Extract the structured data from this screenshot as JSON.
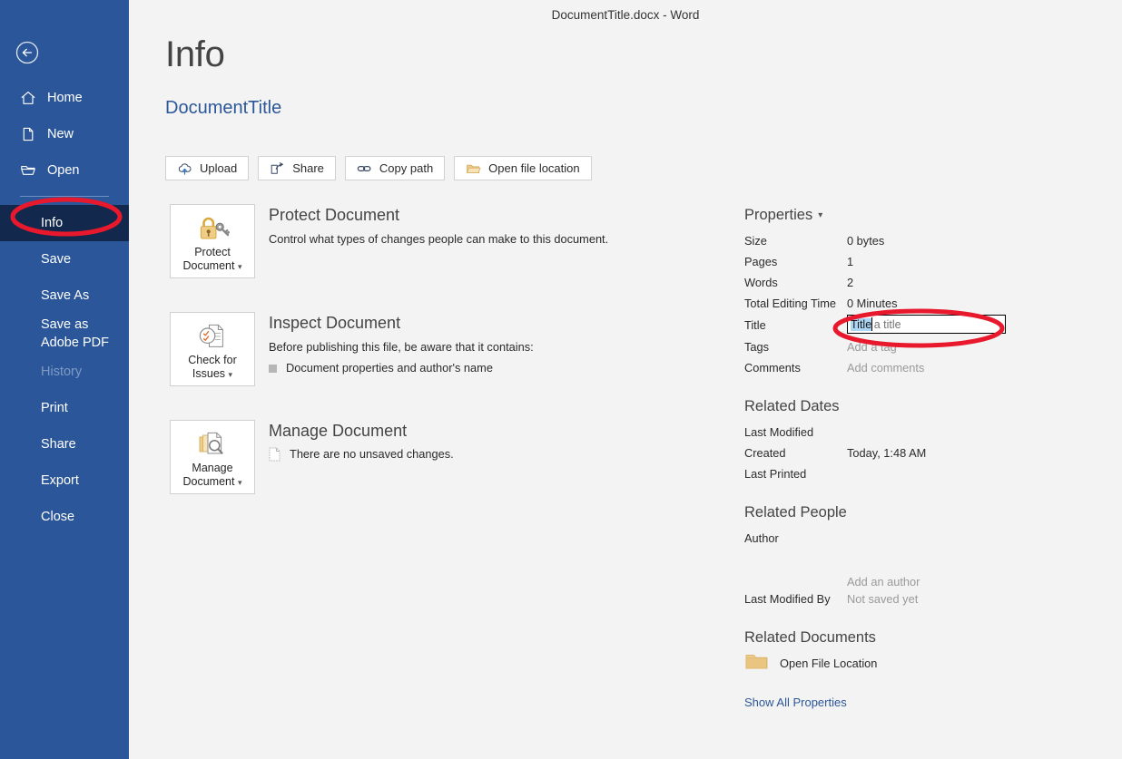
{
  "window": {
    "title": "DocumentTitle.docx  -  Word"
  },
  "sidebar": {
    "back_label": "Back",
    "items": [
      {
        "label": "Home",
        "icon": "home-icon",
        "state": "normal"
      },
      {
        "label": "New",
        "icon": "page-icon",
        "state": "normal"
      },
      {
        "label": "Open",
        "icon": "folder-icon",
        "state": "normal"
      },
      {
        "label": "Info",
        "icon": "",
        "state": "selected"
      },
      {
        "label": "Save",
        "icon": "",
        "state": "normal"
      },
      {
        "label": "Save As",
        "icon": "",
        "state": "normal"
      },
      {
        "label": "Save as Adobe PDF",
        "icon": "",
        "state": "normal"
      },
      {
        "label": "History",
        "icon": "",
        "state": "disabled"
      },
      {
        "label": "Print",
        "icon": "",
        "state": "normal"
      },
      {
        "label": "Share",
        "icon": "",
        "state": "normal"
      },
      {
        "label": "Export",
        "icon": "",
        "state": "normal"
      },
      {
        "label": "Close",
        "icon": "",
        "state": "normal"
      }
    ]
  },
  "page": {
    "heading": "Info",
    "document_name": "DocumentTitle"
  },
  "toolbar": [
    {
      "label": "Upload",
      "icon": "cloud-upload-icon"
    },
    {
      "label": "Share",
      "icon": "share-arrow-icon"
    },
    {
      "label": "Copy path",
      "icon": "link-icon"
    },
    {
      "label": "Open file location",
      "icon": "open-folder-icon"
    }
  ],
  "actions": [
    {
      "tile_label_line1": "Protect",
      "tile_label_line2": "Document",
      "tile_icon": "padlock-key-icon",
      "title": "Protect Document",
      "description": "Control what types of changes people can make to this document.",
      "bullets": []
    },
    {
      "tile_label_line1": "Check for",
      "tile_label_line2": "Issues",
      "tile_icon": "document-inspect-icon",
      "title": "Inspect Document",
      "description": "Before publishing this file, be aware that it contains:",
      "bullets": [
        "Document properties and author's name"
      ]
    },
    {
      "tile_label_line1": "Manage",
      "tile_label_line2": "Document",
      "tile_icon": "manage-document-icon",
      "title": "Manage Document",
      "description": "",
      "status_icon": "unsaved-doc-icon",
      "status": "There are no unsaved changes."
    }
  ],
  "properties": {
    "heading": "Properties",
    "rows": [
      {
        "key": "Size",
        "value": "0 bytes",
        "muted": false
      },
      {
        "key": "Pages",
        "value": "1",
        "muted": false
      },
      {
        "key": "Words",
        "value": "2",
        "muted": false
      },
      {
        "key": "Total Editing Time",
        "value": "0 Minutes",
        "muted": false
      }
    ],
    "title_field": {
      "key": "Title",
      "value": "Title",
      "placeholder": "Add a title",
      "selected_text": "Title",
      "focused": true
    },
    "tail_rows": [
      {
        "key": "Tags",
        "value": "Add a tag",
        "muted": true
      },
      {
        "key": "Comments",
        "value": "Add comments",
        "muted": true
      }
    ]
  },
  "related_dates": {
    "heading": "Related Dates",
    "rows": [
      {
        "key": "Last Modified",
        "value": "",
        "muted": false
      },
      {
        "key": "Created",
        "value": "Today, 1:48 AM",
        "muted": false
      },
      {
        "key": "Last Printed",
        "value": "",
        "muted": false
      }
    ]
  },
  "related_people": {
    "heading": "Related People",
    "author_key": "Author",
    "add_author": "Add an author",
    "last_modified_key": "Last Modified By",
    "last_modified_value": "Not saved yet"
  },
  "related_documents": {
    "heading": "Related Documents",
    "open_file_location": "Open File Location",
    "folder_icon": "folder-icon",
    "show_all": "Show All Properties"
  },
  "annotations": {
    "info_ellipse": "red-ellipse-highlight",
    "title_ellipse": "red-ellipse-highlight"
  },
  "colors": {
    "sidebar": "#2b579a",
    "sidebar_selected": "#12284c",
    "accent_link": "#2b579a",
    "annotation": "#e8192c",
    "canvas": "#f3f3f3",
    "selection": "#add6f5"
  }
}
